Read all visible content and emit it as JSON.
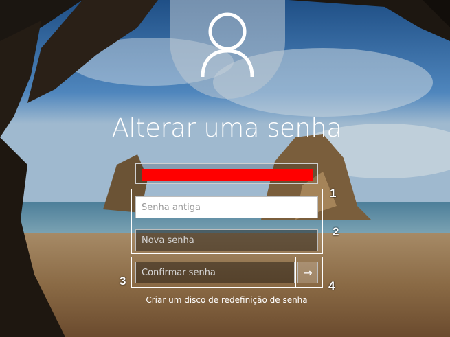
{
  "screen": {
    "title": "Alterar uma senha",
    "user_icon": "user-icon",
    "username_redacted": true,
    "redaction_color": "#ff0000"
  },
  "fields": {
    "old_password": {
      "placeholder": "Senha antiga",
      "value": ""
    },
    "new_password": {
      "placeholder": "Nova senha",
      "value": ""
    },
    "confirm_password": {
      "placeholder": "Confirmar senha",
      "value": ""
    }
  },
  "submit": {
    "icon": "arrow-right-icon",
    "glyph": "→"
  },
  "reset_link": "Criar um disco de redefinição de senha",
  "annotations": [
    "1",
    "2",
    "3",
    "4"
  ]
}
